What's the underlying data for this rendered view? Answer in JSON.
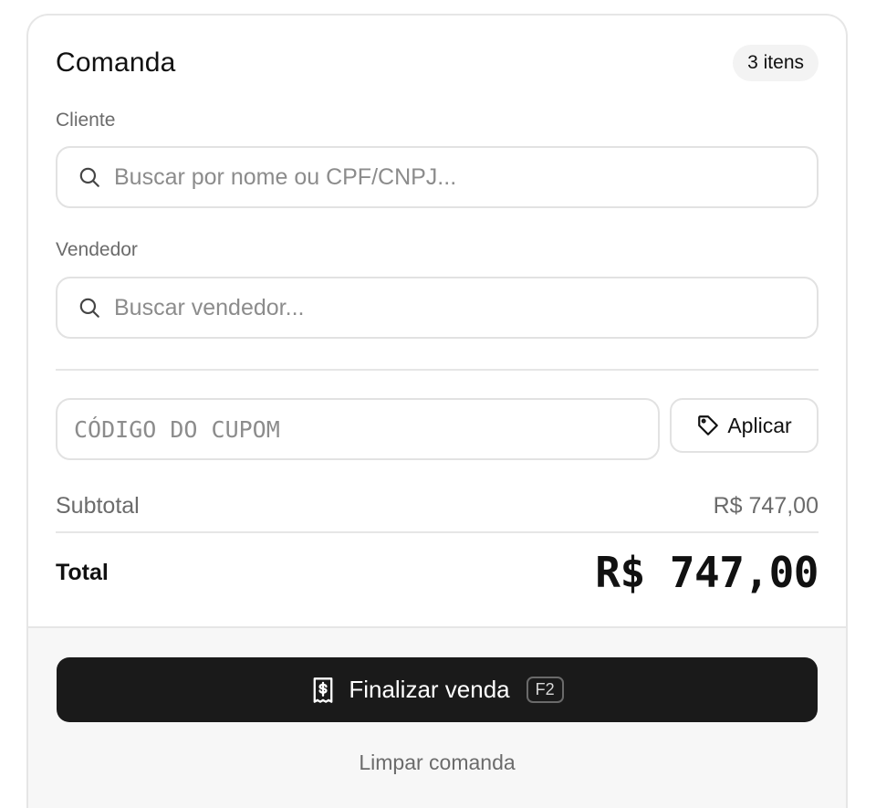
{
  "header": {
    "title": "Comanda",
    "items_badge": "3 itens"
  },
  "cliente": {
    "label": "Cliente",
    "placeholder": "Buscar por nome ou CPF/CNPJ...",
    "value": ""
  },
  "vendedor": {
    "label": "Vendedor",
    "placeholder": "Buscar vendedor...",
    "value": ""
  },
  "coupon": {
    "placeholder": "CÓDIGO DO CUPOM",
    "value": "",
    "apply_label": "Aplicar"
  },
  "summary": {
    "subtotal_label": "Subtotal",
    "subtotal_value": "R$ 747,00",
    "total_label": "Total",
    "total_value": "R$ 747,00"
  },
  "actions": {
    "finalize_label": "Finalizar venda",
    "finalize_shortcut": "F2",
    "clear_label": "Limpar comanda"
  },
  "icons": {
    "search": "search-icon",
    "tag": "tag-icon",
    "receipt": "receipt-icon"
  },
  "colors": {
    "primary_button": "#1a1a1a",
    "muted_text": "#6b6b6b",
    "border": "#e2e2e2",
    "footer_bg": "#f7f7f7"
  }
}
